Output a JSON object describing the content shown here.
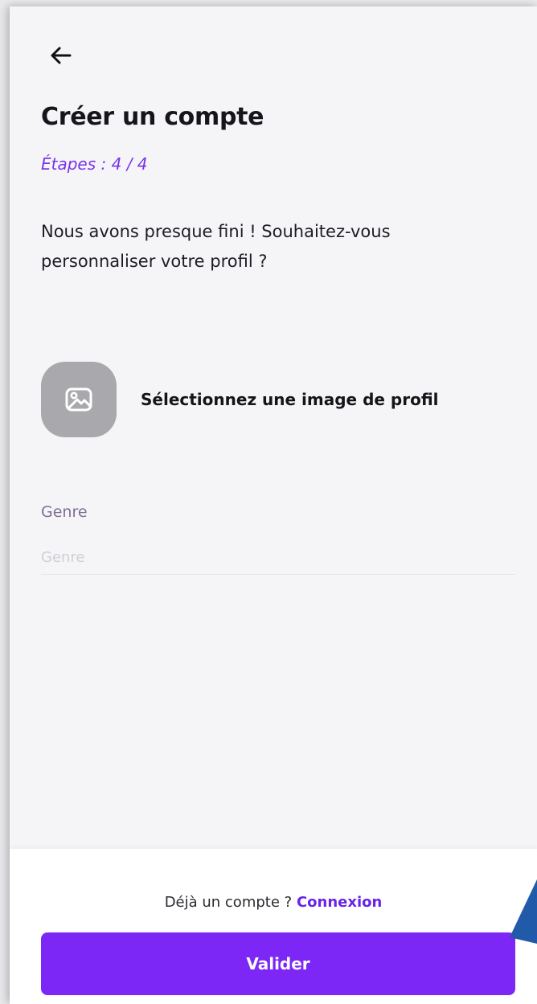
{
  "header": {
    "back_icon": "arrow-left-icon",
    "title": "Créer un compte",
    "steps": "Étapes : 4 / 4"
  },
  "intro": {
    "text": "Nous avons presque fini ! Souhaitez-vous personnaliser votre profil ?"
  },
  "avatar": {
    "icon": "image-icon",
    "label": "Sélectionnez une image de profil"
  },
  "gender_field": {
    "label": "Genre",
    "placeholder": "Genre",
    "value": ""
  },
  "footer": {
    "prompt": "Déjà un compte ?",
    "login_link": "Connexion",
    "submit_label": "Valider"
  },
  "colors": {
    "accent": "#7c27f5",
    "step_text": "#7a34e6",
    "background": "#f5f5f8"
  }
}
